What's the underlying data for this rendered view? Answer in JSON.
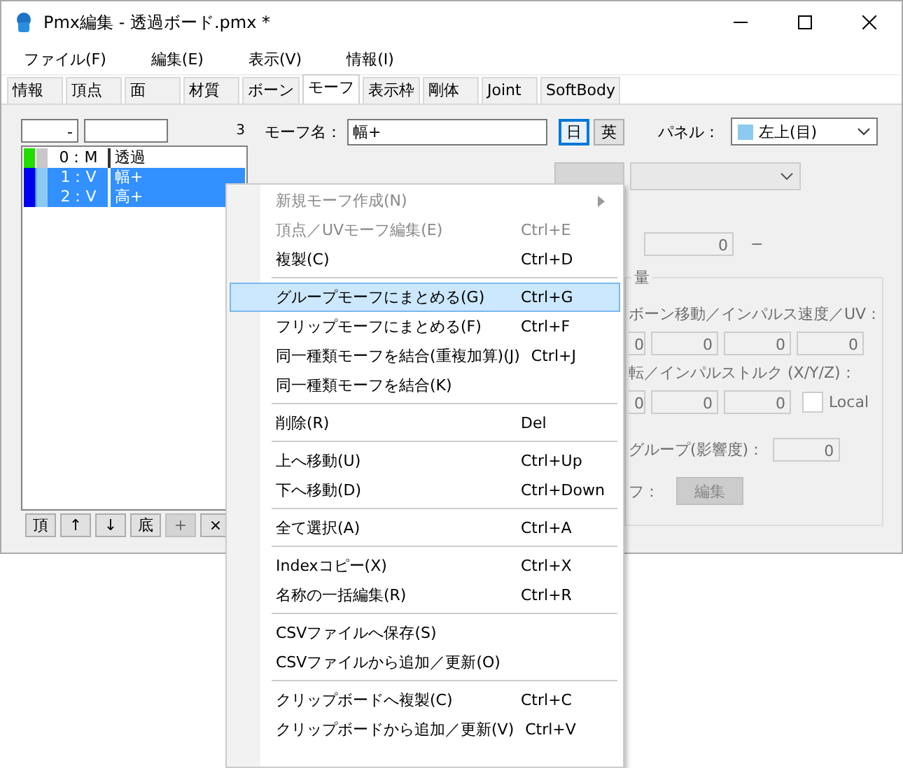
{
  "window": {
    "title": "Pmx編集 - 透過ボード.pmx *"
  },
  "menubar": [
    "ファイル(F)",
    "編集(E)",
    "表示(V)",
    "情報(I)"
  ],
  "tabs": [
    {
      "label": "情報",
      "selected": false
    },
    {
      "label": "頂点",
      "selected": false
    },
    {
      "label": "面",
      "selected": false
    },
    {
      "label": "材質",
      "selected": false
    },
    {
      "label": "ボーン",
      "selected": false
    },
    {
      "label": "モーフ",
      "selected": true
    },
    {
      "label": "表示枠",
      "selected": false
    },
    {
      "label": "剛体",
      "selected": false
    },
    {
      "label": "Joint",
      "selected": false
    },
    {
      "label": "SoftBody",
      "selected": false
    }
  ],
  "morph_list": {
    "filter_value": "-",
    "count": "3",
    "rows": [
      {
        "swatches": [
          {
            "color": "#22dd00"
          },
          {
            "color": "#c8c8c8"
          }
        ],
        "index": "0：M",
        "name": "透過",
        "selected": false
      },
      {
        "swatches": [
          {
            "color": "#0000ee"
          },
          {
            "color": "#8ccaf0"
          }
        ],
        "index": "1：V",
        "name": "幅+",
        "selected": true
      },
      {
        "swatches": [
          {
            "color": "#0000ee"
          },
          {
            "color": "#8ccaf0"
          }
        ],
        "index": "2：V",
        "name": "高+",
        "selected": true
      }
    ],
    "buttons": [
      {
        "label": "頂",
        "disabled": false
      },
      {
        "label": "↑",
        "disabled": false
      },
      {
        "label": "↓",
        "disabled": false
      },
      {
        "label": "底",
        "disabled": false
      },
      {
        "label": "+",
        "disabled": true
      },
      {
        "label": "×",
        "disabled": false
      }
    ]
  },
  "morph_editor": {
    "name_label": "モーフ名：",
    "name_value": "幅+",
    "lang_buttons": [
      {
        "label": "日",
        "selected": true
      },
      {
        "label": "英",
        "selected": false
      }
    ],
    "panel_label": "パネル：",
    "panel_value": "左上(目)",
    "panel_swatch": {
      "color": "#8ccaf0"
    },
    "value_field": "0",
    "value_suffix": "−",
    "group_label": "量",
    "move_label": "ボーン移動／インパルス速度／UV：",
    "move_values": [
      "0",
      "0",
      "0",
      "0"
    ],
    "rotate_label": "転／インパルストルク (X/Y/Z)：",
    "rotate_values": [
      "0",
      "0",
      "0"
    ],
    "local": {
      "label": "Local",
      "checked": false
    },
    "group_weight_label": "グループ(影響度)：",
    "group_weight_value": "0",
    "edit_label": "フ：",
    "edit_button": "編集"
  },
  "context_menu": [
    {
      "kind": "item",
      "label": "新規モーフ作成(N)",
      "disabled": true,
      "submenu": true,
      "selected": false
    },
    {
      "kind": "item",
      "label": "頂点／UVモーフ編集(E)",
      "shortcut": "Ctrl+E",
      "disabled": true,
      "selected": false
    },
    {
      "kind": "item",
      "label": "複製(C)",
      "shortcut": "Ctrl+D",
      "disabled": false,
      "selected": false
    },
    {
      "kind": "separator"
    },
    {
      "kind": "item",
      "label": "グループモーフにまとめる(G)",
      "shortcut": "Ctrl+G",
      "disabled": false,
      "selected": true
    },
    {
      "kind": "item",
      "label": "フリップモーフにまとめる(F)",
      "shortcut": "Ctrl+F",
      "disabled": false,
      "selected": false
    },
    {
      "kind": "item",
      "label": "同一種類モーフを結合(重複加算)(J)",
      "shortcut": "Ctrl+J",
      "disabled": false,
      "selected": false
    },
    {
      "kind": "item",
      "label": "同一種類モーフを結合(K)",
      "disabled": false,
      "selected": false
    },
    {
      "kind": "separator"
    },
    {
      "kind": "item",
      "label": "削除(R)",
      "shortcut": "Del",
      "disabled": false,
      "selected": false
    },
    {
      "kind": "separator"
    },
    {
      "kind": "item",
      "label": "上へ移動(U)",
      "shortcut": "Ctrl+Up",
      "disabled": false,
      "selected": false
    },
    {
      "kind": "item",
      "label": "下へ移動(D)",
      "shortcut": "Ctrl+Down",
      "disabled": false,
      "selected": false
    },
    {
      "kind": "separator"
    },
    {
      "kind": "item",
      "label": "全て選択(A)",
      "shortcut": "Ctrl+A",
      "disabled": false,
      "selected": false
    },
    {
      "kind": "separator"
    },
    {
      "kind": "item",
      "label": "Indexコピー(X)",
      "shortcut": "Ctrl+X",
      "disabled": false,
      "selected": false
    },
    {
      "kind": "item",
      "label": "名称の一括編集(R)",
      "shortcut": "Ctrl+R",
      "disabled": false,
      "selected": false
    },
    {
      "kind": "separator"
    },
    {
      "kind": "item",
      "label": "CSVファイルへ保存(S)",
      "disabled": false,
      "selected": false
    },
    {
      "kind": "item",
      "label": "CSVファイルから追加／更新(O)",
      "disabled": false,
      "selected": false
    },
    {
      "kind": "separator"
    },
    {
      "kind": "item",
      "label": "クリップボードへ複製(C)",
      "shortcut": "Ctrl+C",
      "disabled": false,
      "selected": false
    },
    {
      "kind": "item",
      "label": "クリップボードから追加／更新(V)",
      "shortcut": "Ctrl+V",
      "disabled": false,
      "selected": false
    }
  ]
}
